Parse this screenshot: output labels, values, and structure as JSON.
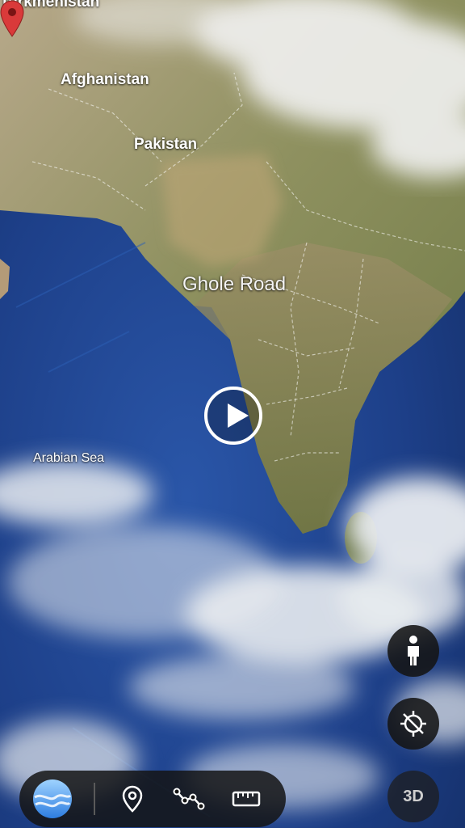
{
  "map": {
    "labels": {
      "turkmenistan": "Turkmenistan",
      "afghanistan": "Afghanistan",
      "pakistan": "Pakistan",
      "arabian_sea": "Arabian Sea",
      "place": "Ghole Road"
    }
  },
  "controls": {
    "three_d_label": "3D",
    "icons": {
      "pegman": "street-view-person-icon",
      "compass": "location-off-icon",
      "globe": "globe-menu-icon",
      "pin": "location-pin-icon",
      "path": "path-line-icon",
      "ruler": "ruler-measure-icon",
      "play": "play-icon",
      "map_marker": "map-marker-icon"
    }
  },
  "colors": {
    "marker": "#d93a3a",
    "ocean": "#1c3f8a",
    "land": "#8a8a55",
    "control_bg": "#141414"
  }
}
